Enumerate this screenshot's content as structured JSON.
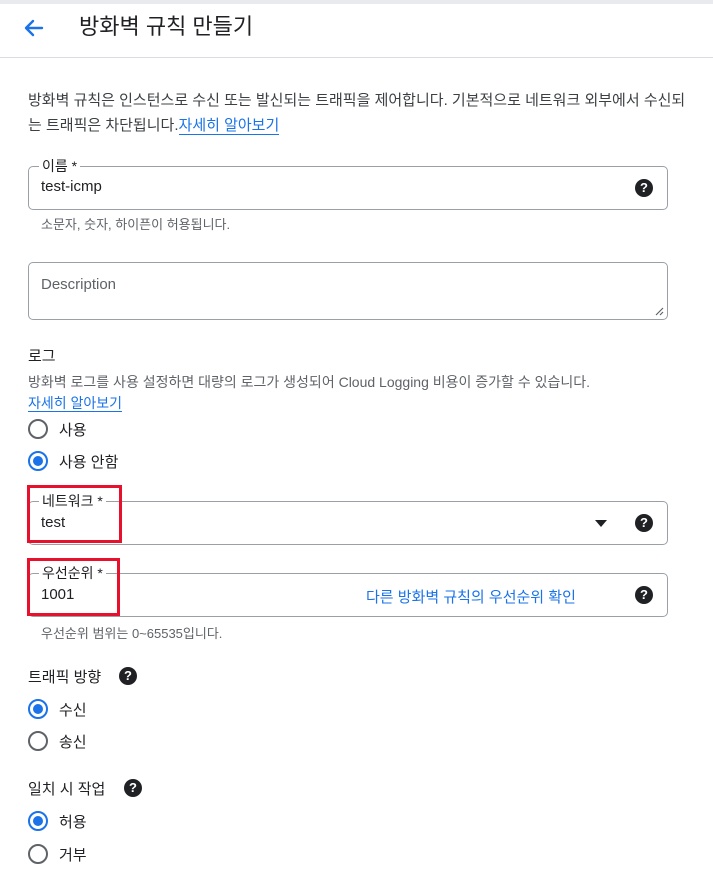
{
  "header": {
    "back_icon": "arrow-back-icon",
    "title": "방화벽 규칙 만들기"
  },
  "intro": {
    "text": "방화벽 규칙은 인스턴스로 수신 또는 발신되는 트래픽을 제어합니다. 기본적으로 네트워크 외부에서 수신되는 트래픽은 차단됩니다.",
    "link": "자세히 알아보기"
  },
  "name_field": {
    "label": "이름 *",
    "value": "test-icmp",
    "hint": "소문자, 숫자, 하이픈이 허용됩니다.",
    "help_icon": "help-icon"
  },
  "description_field": {
    "placeholder": "Description"
  },
  "logs": {
    "title": "로그",
    "description": "방화벽 로그를 사용 설정하면 대량의 로그가 생성되어 Cloud Logging 비용이 증가할 수 있습니다.",
    "link": "자세히 알아보기",
    "options": [
      {
        "label": "사용",
        "checked": false
      },
      {
        "label": "사용 안함",
        "checked": true
      }
    ]
  },
  "network_field": {
    "label": "네트워크 *",
    "value": "test",
    "help_icon": "help-icon"
  },
  "priority_field": {
    "label": "우선순위 *",
    "value": "1001",
    "link": "다른 방화벽 규칙의 우선순위 확인",
    "hint": "우선순위 범위는 0~65535입니다.",
    "help_icon": "help-icon"
  },
  "direction": {
    "title": "트래픽 방향",
    "options": [
      {
        "label": "수신",
        "checked": true
      },
      {
        "label": "송신",
        "checked": false
      }
    ]
  },
  "action": {
    "title": "일치 시 작업",
    "options": [
      {
        "label": "허용",
        "checked": true
      },
      {
        "label": "거부",
        "checked": false
      }
    ]
  },
  "colors": {
    "accent": "#1a73e8",
    "highlight": "#e8112d"
  }
}
